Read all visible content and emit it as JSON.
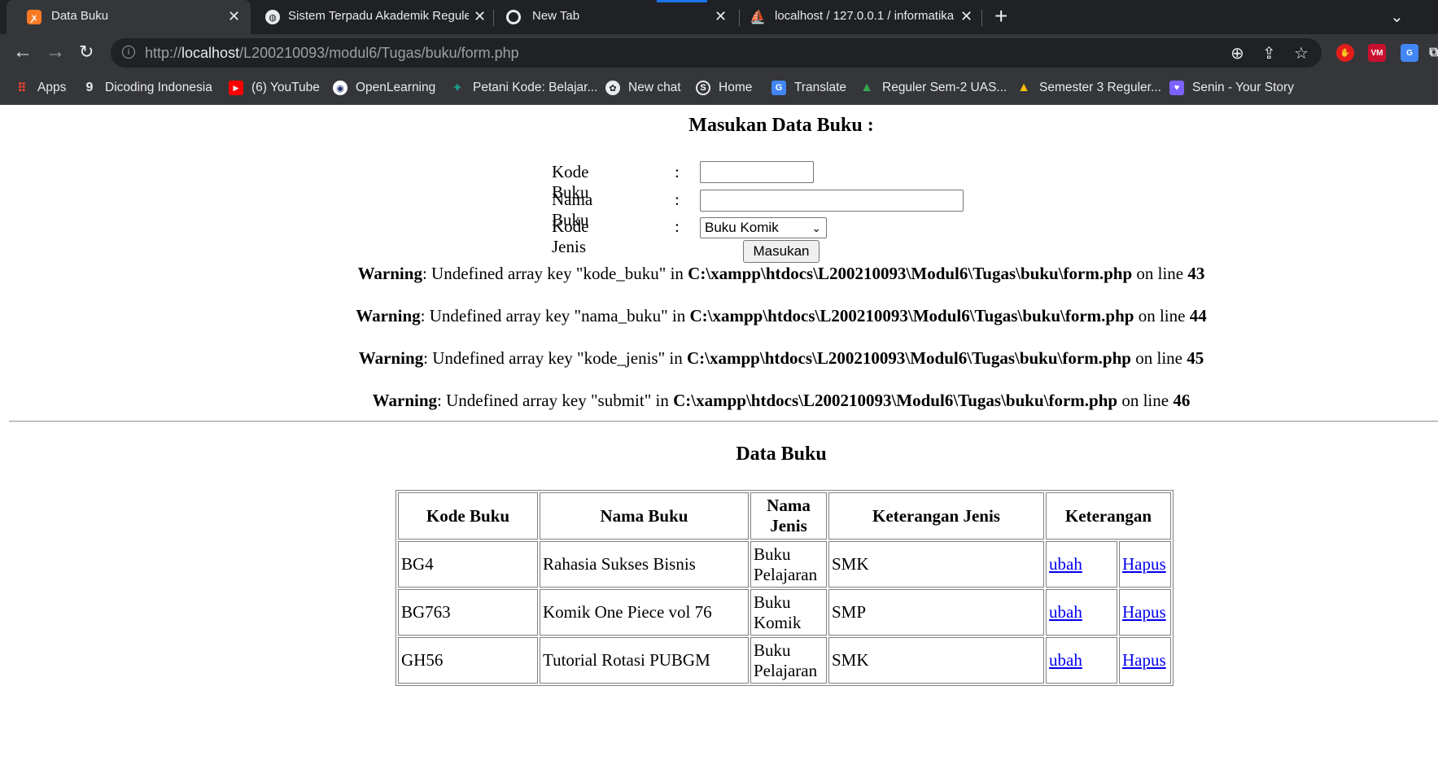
{
  "browser": {
    "tabs": [
      {
        "title": "Data Buku",
        "icon": "xampp-icon"
      },
      {
        "title": "Sistem Terpadu Akademik Reguler",
        "icon": "globe-icon"
      },
      {
        "title": "New Tab",
        "icon": "chrome-icon"
      },
      {
        "title": "localhost / 127.0.0.1 / informatika",
        "icon": "phpmyadmin-icon"
      }
    ],
    "url_prefix": "http://",
    "url_host": "localhost",
    "url_path": "/L200210093/modul6/Tugas/buku/form.php",
    "bookmarks": [
      {
        "label": "Apps",
        "icon": "apps-grid-icon",
        "color": "#ea4335"
      },
      {
        "label": "Dicoding Indonesia",
        "icon": "dicoding-icon",
        "color": "#2d3e50"
      },
      {
        "label": "(6) YouTube",
        "icon": "youtube-icon",
        "color": "#ff0000"
      },
      {
        "label": "OpenLearning",
        "icon": "openlearning-icon",
        "color": "#1c2a6b"
      },
      {
        "label": "Petani Kode: Belajar...",
        "icon": "petanikode-icon",
        "color": "#1a9b8a"
      },
      {
        "label": "New chat",
        "icon": "chatgpt-icon",
        "color": "#10a37f"
      },
      {
        "label": "Home",
        "icon": "skype-icon",
        "color": "#00aff0"
      },
      {
        "label": "Translate",
        "icon": "translate-icon",
        "color": "#4285f4"
      },
      {
        "label": "Reguler Sem-2 UAS...",
        "icon": "drive-icon",
        "color": "#34a853"
      },
      {
        "label": "Semester 3 Reguler...",
        "icon": "drive-icon",
        "color": "#fbbc04"
      },
      {
        "label": "Senin - Your Story",
        "icon": "heart-icon",
        "color": "#7b61ff"
      }
    ]
  },
  "form": {
    "heading": "Masukan Data Buku :",
    "fields": [
      {
        "label": "Kode Buku",
        "colon": ":"
      },
      {
        "label": "Nama Buku",
        "colon": ":"
      },
      {
        "label": "Kode Jenis",
        "colon": ":"
      }
    ],
    "select_value": "Buku Komik",
    "submit_label": "Masukan"
  },
  "warnings": [
    {
      "prefix": "Warning",
      "text": ": Undefined array key \"kode_buku\" in ",
      "path": "C:\\xampp\\htdocs\\L200210093\\Modul6\\Tugas\\buku\\form.php",
      "on_line": " on line ",
      "line": "43"
    },
    {
      "prefix": "Warning",
      "text": ": Undefined array key \"nama_buku\" in ",
      "path": "C:\\xampp\\htdocs\\L200210093\\Modul6\\Tugas\\buku\\form.php",
      "on_line": " on line ",
      "line": "44"
    },
    {
      "prefix": "Warning",
      "text": ": Undefined array key \"kode_jenis\" in ",
      "path": "C:\\xampp\\htdocs\\L200210093\\Modul6\\Tugas\\buku\\form.php",
      "on_line": " on line ",
      "line": "45"
    },
    {
      "prefix": "Warning",
      "text": ": Undefined array key \"submit\" in ",
      "path": "C:\\xampp\\htdocs\\L200210093\\Modul6\\Tugas\\buku\\form.php",
      "on_line": " on line ",
      "line": "46"
    }
  ],
  "table": {
    "heading": "Data Buku",
    "headers": [
      "Kode Buku",
      "Nama Buku",
      "Nama Jenis",
      "Keterangan Jenis",
      "Keterangan"
    ],
    "rows": [
      {
        "kode": "BG4",
        "nama": "Rahasia Sukses Bisnis",
        "jenis": "Buku Pelajaran",
        "ket_jenis": "SMK",
        "edit": "ubah",
        "delete": "Hapus"
      },
      {
        "kode": "BG763",
        "nama": "Komik One Piece vol 76",
        "jenis": "Buku Komik",
        "ket_jenis": "SMP",
        "edit": "ubah",
        "delete": "Hapus"
      },
      {
        "kode": "GH56",
        "nama": "Tutorial Rotasi PUBGM",
        "jenis": "Buku Pelajaran",
        "ket_jenis": "SMK",
        "edit": "ubah",
        "delete": "Hapus"
      }
    ]
  }
}
